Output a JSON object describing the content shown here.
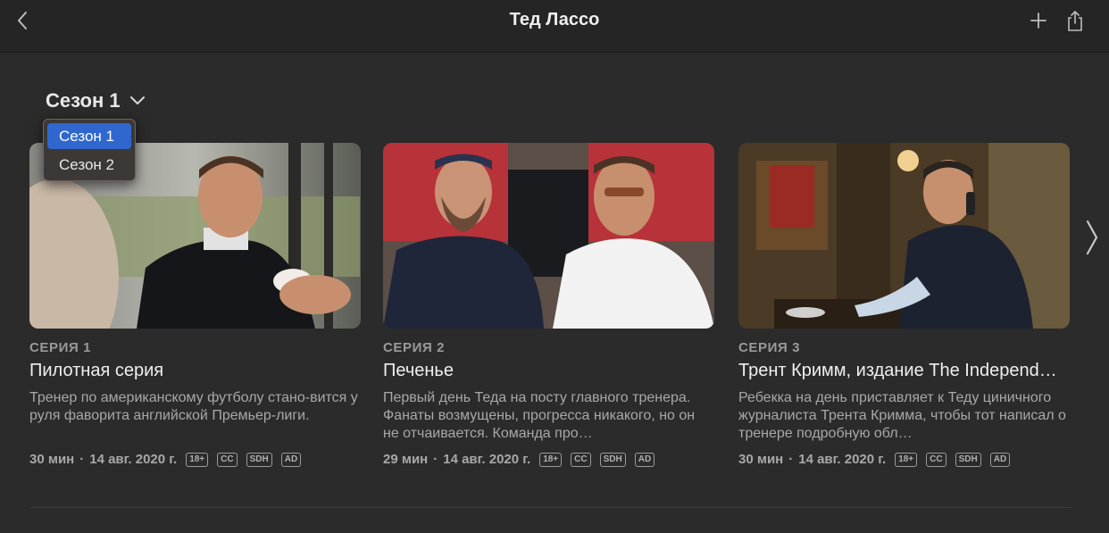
{
  "window": {
    "title": "Тед Лассо"
  },
  "season_picker": {
    "current": "Сезон 1",
    "options": [
      "Сезон 1",
      "Сезон 2"
    ]
  },
  "episodes": [
    {
      "number": "СЕРИЯ 1",
      "title": "Пилотная серия",
      "description": "Тренер по американскому футболу стано-вится у руля фаворита английской Премьер-лиги.",
      "duration": "30 мин",
      "date": "14 авг. 2020 г.",
      "badges": [
        "18+",
        "CC",
        "SDH",
        "AD"
      ]
    },
    {
      "number": "СЕРИЯ 2",
      "title": "Печенье",
      "description": "Первый день Теда на посту главного тренера. Фанаты возмущены, прогресса никакого, но он не отчаивается. Команда про…",
      "duration": "29 мин",
      "date": "14 авг. 2020 г.",
      "badges": [
        "18+",
        "CC",
        "SDH",
        "AD"
      ]
    },
    {
      "number": "СЕРИЯ 3",
      "title": "Трент Кримм, издание The Independ…",
      "description": "Ребекка на день приставляет к Теду циничного журналиста Трента Кримма, чтобы тот написал о тренере подробную обл…",
      "duration": "30 мин",
      "date": "14 авг. 2020 г.",
      "badges": [
        "18+",
        "CC",
        "SDH",
        "AD"
      ]
    }
  ],
  "meta_separator": "·",
  "icons": {
    "back": "chevron-left-icon",
    "add": "plus-icon",
    "share": "share-icon",
    "season_dropdown": "chevron-down-icon",
    "next_page": "chevron-right-icon"
  },
  "colors": {
    "background": "#2b2b2b",
    "selected_menu": "#2f67cf"
  }
}
